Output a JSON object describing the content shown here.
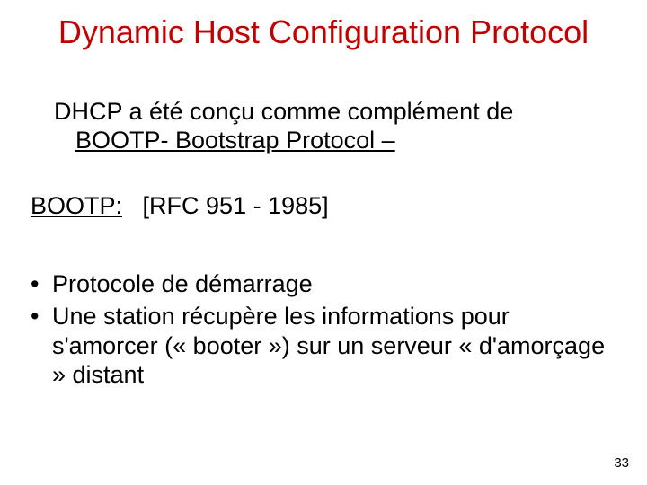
{
  "title": "Dynamic Host Configuration Protocol",
  "intro": {
    "line1": "DHCP a été conçu comme complément de",
    "line2_underlined": "BOOTP- Bootstrap Protocol –"
  },
  "ref": {
    "label": "BOOTP:",
    "value": "[RFC 951 - 1985]"
  },
  "bullets": [
    "Protocole de démarrage",
    "Une station récupère les informations pour s'amorcer (« booter ») sur un serveur « d'amorçage » distant"
  ],
  "page_number": "33"
}
